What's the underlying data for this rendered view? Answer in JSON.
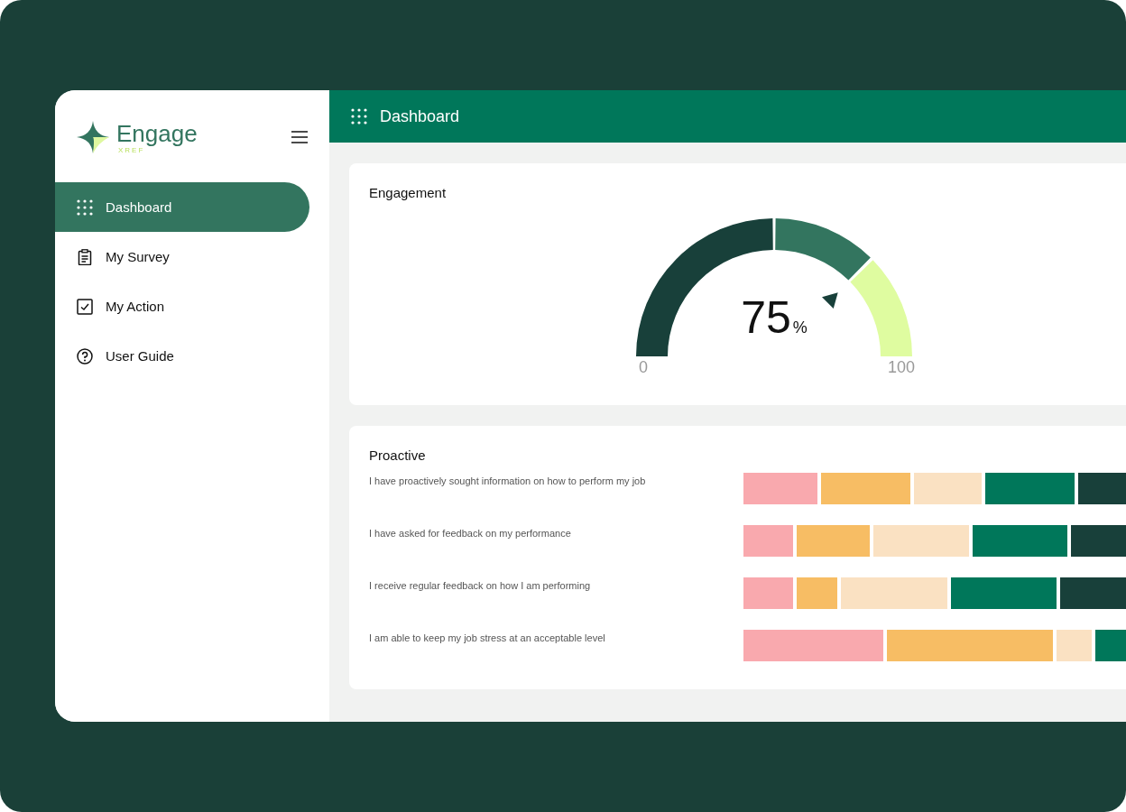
{
  "sidebar": {
    "logo": {
      "name": "Engage",
      "sub": "XREF"
    },
    "items": [
      {
        "label": "Dashboard",
        "kind": "grid",
        "selected": true
      },
      {
        "label": "My Survey",
        "kind": "clipboard",
        "selected": false
      },
      {
        "label": "My Action",
        "kind": "checkbox",
        "selected": false
      },
      {
        "label": "User Guide",
        "kind": "help",
        "selected": false
      }
    ]
  },
  "header": {
    "title": "Dashboard"
  },
  "engagement": {
    "title": "Engagement",
    "gauge": {
      "level": 0.75,
      "value": "75",
      "unit": "%",
      "min": "0",
      "max": "100"
    }
  },
  "proactive": {
    "title": "Proactive",
    "rows": [
      {
        "label": "I have proactively sought information on how to perform my job"
      },
      {
        "label": "I have asked for feedback on my performance"
      },
      {
        "label": "I receive regular feedback on how I am performing"
      },
      {
        "label": "I am able to keep my job stress at an acceptable level"
      }
    ]
  }
}
